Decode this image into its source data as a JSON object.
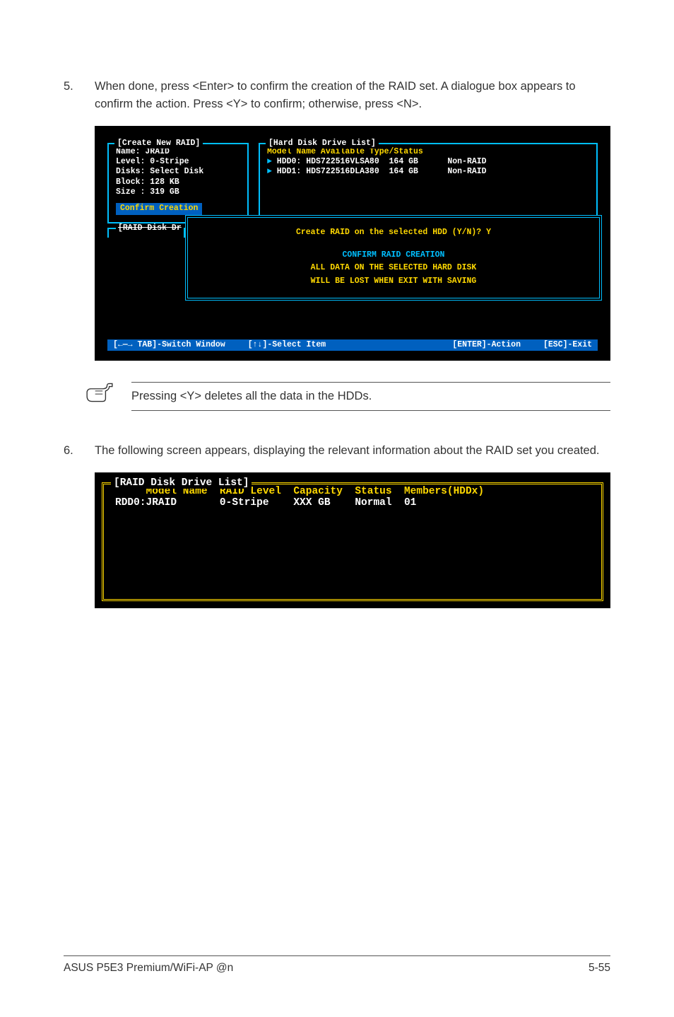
{
  "step5": {
    "number": "5.",
    "text": "When done, press <Enter> to confirm the creation of the RAID set. A dialogue box appears to confirm the action. Press <Y> to confirm; otherwise, press <N>."
  },
  "bios1": {
    "createTitle": "[Create New RAID]",
    "nameLine": "Name: JRAID",
    "levelLine": "Level: 0-Stripe",
    "disksLine": "Disks: Select Disk",
    "blockLine": "Block: 128 KB",
    "sizeLine": "Size : 319 GB",
    "confirmCreation": "Confirm Creation",
    "hddTitle": "[Hard Disk Drive List]",
    "hddHeader": "       Model Name       Available   Type/Status",
    "hddRow0": " HDD0: HDS722516VLSA80  164 GB      Non-RAID",
    "hddRow1": " HDD1: HDS722516DLA380  164 GB      Non-RAID",
    "raidDrTitle": "[RAID Disk Dr",
    "dialogLine1": "Create RAID on the selected HDD (Y/N)? Y",
    "dialogLine2": "CONFIRM RAID CREATION",
    "dialogLine3": "ALL DATA ON THE SELECTED HARD DISK",
    "dialogLine4": "WILL BE LOST WHEN EXIT WITH SAVING",
    "footerTab": "[←—→ TAB]-Switch Window",
    "footerSelect": "[↑↓]-Select Item",
    "footerEnter": "[ENTER]-Action",
    "footerEsc": "[ESC]-Exit"
  },
  "note": {
    "text": "Pressing <Y> deletes all the data in the HDDs."
  },
  "step6": {
    "number": "6.",
    "text": "The following screen appears, displaying the relevant information about the RAID set you created."
  },
  "bios2": {
    "title": "[RAID Disk Drive List]",
    "header": "     Model Name  RAID Level  Capacity  Status  Members(HDDx)",
    "row": "RDD0:JRAID       0-Stripe    XXX GB    Normal  01"
  },
  "footer": {
    "left": "ASUS P5E3 Premium/WiFi-AP @n",
    "right": "5-55"
  }
}
